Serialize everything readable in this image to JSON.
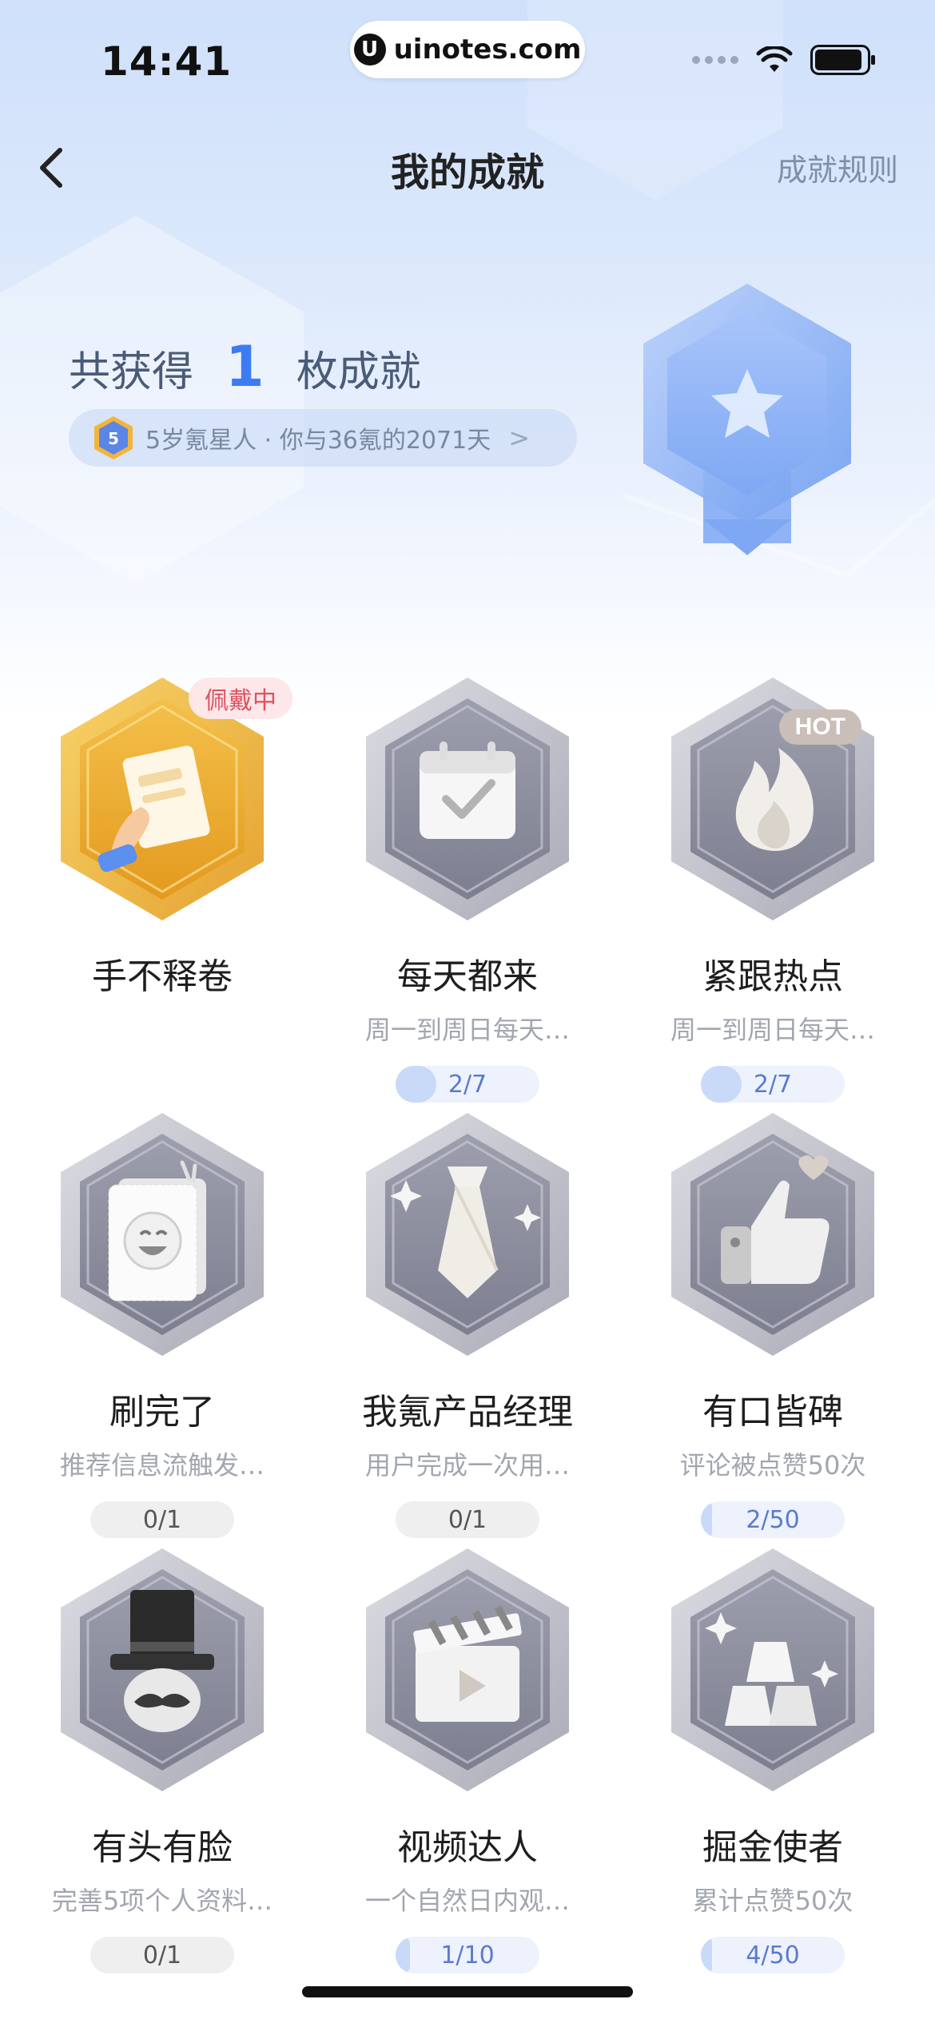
{
  "status_bar": {
    "time": "14:41",
    "url": "uinotes.com"
  },
  "nav": {
    "title": "我的成就",
    "rules_link": "成就规则"
  },
  "summary": {
    "prefix": "共获得",
    "count": "1",
    "suffix": "枚成就",
    "level_badge": "5",
    "age_text": "5岁氪星人 · 你与36氪的2071天",
    "chevron": ">"
  },
  "achievements": [
    {
      "name": "手不释卷",
      "desc": "",
      "progress_text": "",
      "progress": null,
      "tag": "佩戴中",
      "icon": "reading-hand-icon",
      "unlocked": true
    },
    {
      "name": "每天都来",
      "desc": "周一到周日每天…",
      "progress_text": "2/7",
      "progress": 0.2857,
      "tag": "",
      "icon": "calendar-check-icon",
      "unlocked": false
    },
    {
      "name": "紧跟热点",
      "desc": "周一到周日每天…",
      "progress_text": "2/7",
      "progress": 0.2857,
      "tag": "HOT",
      "icon": "flame-icon",
      "unlocked": false
    },
    {
      "name": "刷完了",
      "desc": "推荐信息流触发…",
      "progress_text": "0/1",
      "progress": 0,
      "tag": "",
      "icon": "laughing-face-icon",
      "unlocked": false
    },
    {
      "name": "我氪产品经理",
      "desc": "用户完成一次用…",
      "progress_text": "0/1",
      "progress": 0,
      "tag": "",
      "icon": "necktie-icon",
      "unlocked": false
    },
    {
      "name": "有口皆碑",
      "desc": "评论被点赞50次",
      "progress_text": "2/50",
      "progress": 0.04,
      "tag": "",
      "icon": "thumbs-up-icon",
      "unlocked": false
    },
    {
      "name": "有头有脸",
      "desc": "完善5项个人资料…",
      "progress_text": "0/1",
      "progress": 0,
      "tag": "",
      "icon": "top-hat-mustache-icon",
      "unlocked": false
    },
    {
      "name": "视频达人",
      "desc": "一个自然日内观…",
      "progress_text": "1/10",
      "progress": 0.1,
      "tag": "",
      "icon": "clapperboard-icon",
      "unlocked": false
    },
    {
      "name": "掘金使者",
      "desc": "累计点赞50次",
      "progress_text": "4/50",
      "progress": 0.08,
      "tag": "",
      "icon": "gold-bars-icon",
      "unlocked": false
    }
  ],
  "colors": {
    "accent": "#3d7cf0",
    "wearing_tag": "#e0525f",
    "progress_fill": "#c9d9f8"
  }
}
